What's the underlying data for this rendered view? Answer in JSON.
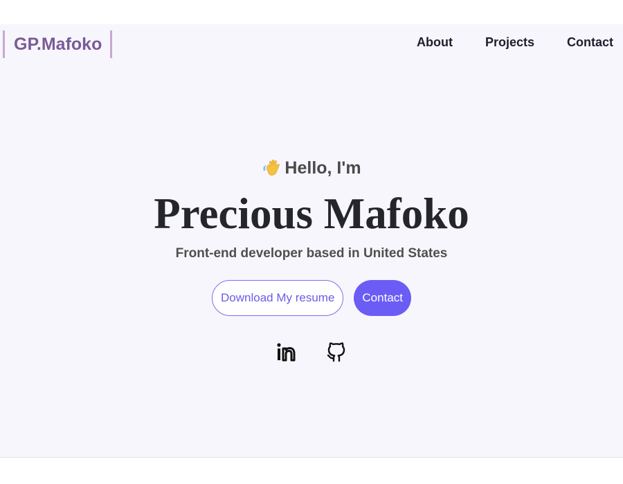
{
  "header": {
    "logo": "GP.Mafoko",
    "nav": [
      {
        "label": "About"
      },
      {
        "label": "Projects"
      },
      {
        "label": "Contact"
      }
    ]
  },
  "hero": {
    "greeting": "Hello, I'm",
    "greeting_icon": "waving-hand-icon",
    "name": "Precious Mafoko",
    "subtitle": "Front-end developer based in United States",
    "resume_button": "Download My resume",
    "contact_button": "Contact"
  },
  "socials": [
    {
      "icon": "linkedin-icon"
    },
    {
      "icon": "github-icon"
    }
  ],
  "colors": {
    "accent": "#6b5cf6",
    "logo": "#7a5a98",
    "background": "#f7f6fc"
  }
}
